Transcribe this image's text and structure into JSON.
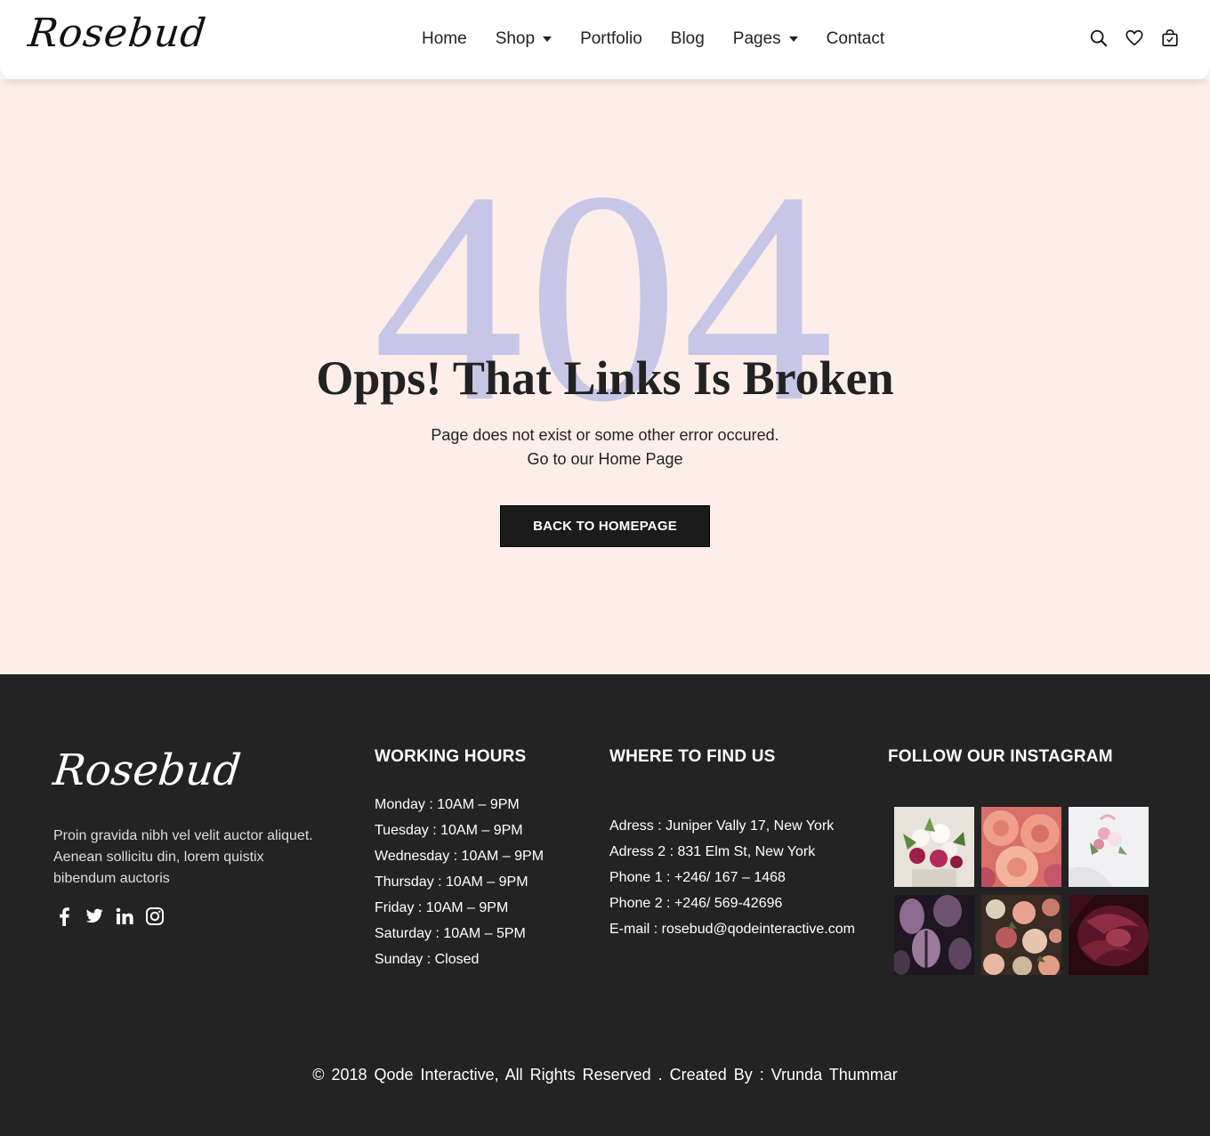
{
  "header": {
    "logo": "Rosebud",
    "nav": [
      {
        "label": "Home",
        "dropdown": false
      },
      {
        "label": "Shop",
        "dropdown": true
      },
      {
        "label": "Portfolio",
        "dropdown": false
      },
      {
        "label": "Blog",
        "dropdown": false
      },
      {
        "label": "Pages",
        "dropdown": true
      },
      {
        "label": "Contact",
        "dropdown": false
      }
    ],
    "icons": [
      "search-icon",
      "heart-icon",
      "shopping-bag-icon"
    ]
  },
  "hero": {
    "code": "404",
    "title": "Opps! That Links Is Broken",
    "line1": "Page does not exist or some other error occured.",
    "line2": "Go to our Home Page",
    "button": "BACK TO HOMEPAGE"
  },
  "footer": {
    "logo": "Rosebud",
    "about": "Proin gravida nibh vel velit auctor aliquet. Aenean sollicitu din, lorem quistix bibendum auctoris",
    "social": [
      "facebook-icon",
      "twitter-icon",
      "linkedin-icon",
      "instagram-icon"
    ],
    "hours": {
      "title": "WORKING HOURS",
      "items": [
        "Monday : 10AM – 9PM",
        "Tuesday : 10AM – 9PM",
        "Wednesday : 10AM – 9PM",
        "Thursday : 10AM – 9PM",
        "Friday : 10AM – 9PM",
        "Saturday : 10AM – 5PM",
        "Sunday : Closed"
      ]
    },
    "find": {
      "title": "WHERE TO FIND US",
      "items": [
        "Adress : Juniper Vally 17, New York",
        "Adress 2 : 831 Elm St, New York",
        "Phone 1 : +246/ 167 – 1468",
        "Phone 2 : +246/ 569-42696",
        "E-mail : rosebud@qodeinteractive.com"
      ]
    },
    "instagram": {
      "title": "FOLLOW OUR INSTAGRAM",
      "tiles": [
        {
          "name": "bouquet-white-lilies",
          "colors": [
            "#e7e2da",
            "#5b8a3c",
            "#9c1f4a"
          ]
        },
        {
          "name": "pink-roses",
          "colors": [
            "#e8907a",
            "#c4566a",
            "#f4b39c"
          ]
        },
        {
          "name": "bridal-bouquet",
          "colors": [
            "#f1f1f3",
            "#e9a9bb",
            "#6f8f5e"
          ]
        },
        {
          "name": "purple-tulips",
          "colors": [
            "#3b2a3c",
            "#8d6b8f",
            "#1e1620"
          ]
        },
        {
          "name": "mixed-flowers",
          "colors": [
            "#3a2b24",
            "#e8a28e",
            "#d9d2b8"
          ]
        },
        {
          "name": "dark-red-flower",
          "colors": [
            "#5a1628",
            "#8e2e45",
            "#2a0a12"
          ]
        }
      ]
    },
    "copyright": "© 2018 Qode Interactive, All Rights Reserved . Created By : Vrunda Thummar"
  }
}
